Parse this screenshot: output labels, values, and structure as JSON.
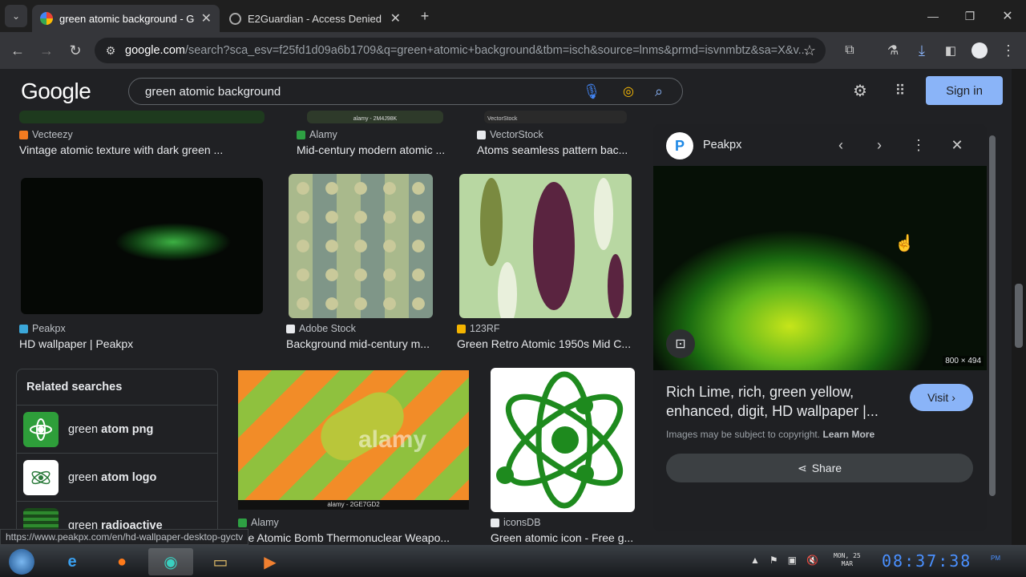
{
  "browser": {
    "tabs": [
      {
        "title": "green atomic background - Go",
        "active": true
      },
      {
        "title": "E2Guardian - Access Denied",
        "active": false
      }
    ],
    "url_host": "google.com",
    "url_path": "/search?sca_esv=f25fd1d09a6b1709&q=green+atomic+background&tbm=isch&source=lnms&prmd=isvnmbtz&sa=X&v..."
  },
  "google": {
    "logo": "Google",
    "query": "green atomic background",
    "signin": "Sign in"
  },
  "results": {
    "row0": [
      {
        "source": "Vecteezy",
        "title": "Vintage atomic texture with dark green ...",
        "watermark": ""
      },
      {
        "source": "Alamy",
        "title": "Mid-century modern atomic ...",
        "watermark": "alamy - 2M4J98K"
      },
      {
        "source": "VectorStock",
        "title": "Atoms seamless pattern bac...",
        "watermark": "VectorStock"
      }
    ],
    "row1": [
      {
        "source": "Peakpx",
        "title": "HD wallpaper | Peakpx"
      },
      {
        "source": "Adobe Stock",
        "title": "Background mid-century m..."
      },
      {
        "source": "123RF",
        "title": "Green Retro Atomic 1950s Mid C..."
      }
    ],
    "row2": [
      {
        "source": "Alamy",
        "title": "rge Atomic Bomb Thermonuclear Weapo...",
        "watermark": "alamy - 2GE7GD2",
        "wm_big": "alamy"
      },
      {
        "source": "iconsDB",
        "title": "Green atomic icon - Free g..."
      }
    ]
  },
  "related": {
    "heading": "Related searches",
    "items": [
      {
        "prefix": "green ",
        "bold": "atom png"
      },
      {
        "prefix": "green ",
        "bold": "atom logo"
      },
      {
        "prefix": "green ",
        "bold": "radioactive"
      }
    ]
  },
  "panel": {
    "site": "Peakpx",
    "dimensions": "800 × 494",
    "title": "Rich Lime, rich, green yellow, enhanced, digit, HD wallpaper |...",
    "visit": "Visit",
    "copyright": "Images may be subject to copyright.",
    "learn_more": "Learn More",
    "share": "Share"
  },
  "status_url": "https://www.peakpx.com/en/hd-wallpaper-desktop-gyctv",
  "taskbar": {
    "day": "MON, 25",
    "month": "MAR",
    "time": "08:37:38",
    "ampm": "PM"
  }
}
